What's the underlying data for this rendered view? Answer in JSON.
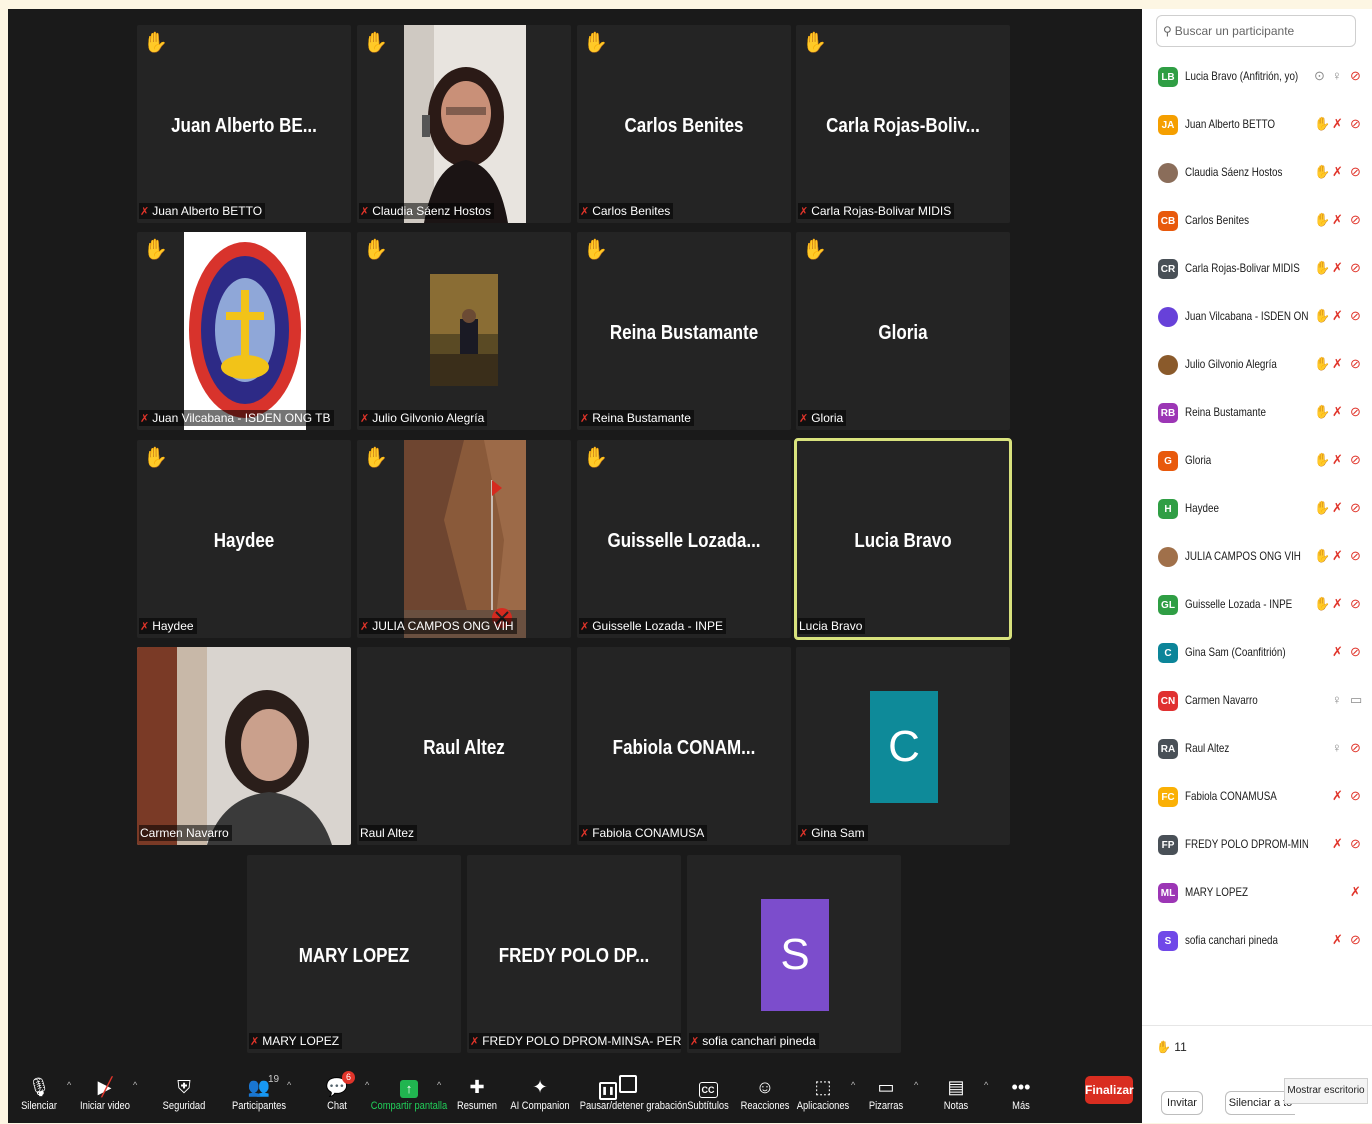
{
  "tiles": [
    {
      "center": "Juan Alberto BE...",
      "label": "Juan Alberto BETTO",
      "muted": true,
      "hand": true
    },
    {
      "center": "",
      "label": "Claudia Sáenz Hostos",
      "muted": true,
      "hand": true,
      "photo": "woman-smiling"
    },
    {
      "center": "Carlos Benites",
      "label": "Carlos Benites",
      "muted": true,
      "hand": true
    },
    {
      "center": "Carla Rojas-Boliv...",
      "label": "Carla Rojas-Bolivar MIDIS",
      "muted": true,
      "hand": true
    },
    {
      "center": "",
      "label": "Juan Vilcabana - ISDEN ONG TB",
      "muted": true,
      "hand": true,
      "photo": "instituto-logo",
      "logo_text": "INSTITUTO DE SALUD-MSC",
      "logo_sub": "CRISTOBAL BENEKE",
      "logo_motto": "Servir a la Vida"
    },
    {
      "center": "",
      "label": "Julio Gilvonio Alegría",
      "muted": true,
      "hand": true,
      "photo": "assembly-hall"
    },
    {
      "center": "Reina Bustamante",
      "label": "Reina Bustamante",
      "muted": true,
      "hand": true
    },
    {
      "center": "Gloria",
      "label": "Gloria",
      "muted": true,
      "hand": true
    },
    {
      "center": "Haydee",
      "label": "Haydee",
      "muted": true,
      "hand": true
    },
    {
      "center": "",
      "label": "JULIA CAMPOS  ONG VIH",
      "muted": true,
      "hand": true,
      "photo": "rock-cliff"
    },
    {
      "center": "Guisselle  Lozada...",
      "label": "Guisselle Lozada - INPE",
      "muted": true,
      "hand": true
    },
    {
      "center": "Lucia Bravo",
      "label": "Lucia Bravo",
      "muted": false,
      "hand": false,
      "active": true
    },
    {
      "center": "",
      "label": "Carmen Navarro",
      "muted": false,
      "hand": false,
      "photo": "live-video"
    },
    {
      "center": "Raul Altez",
      "label": "Raul Altez",
      "muted": false,
      "hand": false
    },
    {
      "center": "Fabiola  CONAM...",
      "label": "Fabiola CONAMUSA",
      "muted": true,
      "hand": false
    },
    {
      "center": "",
      "label": "Gina Sam",
      "muted": true,
      "hand": false,
      "avatar": "C",
      "avatar_color": "#0e8a99"
    },
    {
      "center": "MARY LOPEZ",
      "label": "MARY LOPEZ",
      "muted": true,
      "hand": false
    },
    {
      "center": "FREDY POLO DP...",
      "label": "FREDY POLO DPROM-MINSA- PERU",
      "muted": true,
      "hand": false
    },
    {
      "center": "",
      "label": "sofia canchari pineda",
      "muted": true,
      "hand": false,
      "avatar": "S",
      "avatar_color": "#7c4dcc"
    }
  ],
  "panel": {
    "search_placeholder": "Buscar un participante",
    "participants": [
      {
        "initials": "LB",
        "color": "#2f9e44",
        "name": "Lucia Bravo (Anfitrión, yo)",
        "icons": [
          "share",
          "mic",
          "vid-off"
        ]
      },
      {
        "initials": "JA",
        "color": "#f59f00",
        "name": "Juan Alberto BETTO",
        "icons": [
          "hand",
          "mic-off",
          "vid-off"
        ]
      },
      {
        "initials": "",
        "color": "#8a6d5a",
        "name": "Claudia Sáenz Hostos",
        "icons": [
          "hand-dim",
          "mic-off",
          "vid-off"
        ],
        "photo": true
      },
      {
        "initials": "CB",
        "color": "#e8590c",
        "name": "Carlos Benites",
        "icons": [
          "hand",
          "mic-off",
          "vid-off"
        ]
      },
      {
        "initials": "CR",
        "color": "#495057",
        "name": "Carla Rojas-Bolivar MIDIS",
        "icons": [
          "hand",
          "mic-off",
          "vid-off"
        ]
      },
      {
        "initials": "",
        "color": "#6741d9",
        "name": "Juan Vilcabana - ISDEN ON...",
        "icons": [
          "hand",
          "mic-off",
          "vid-off"
        ],
        "photo": true
      },
      {
        "initials": "",
        "color": "#8a5a2b",
        "name": "Julio Gilvonio Alegría",
        "icons": [
          "hand",
          "mic-off",
          "vid-off"
        ],
        "photo": true
      },
      {
        "initials": "RB",
        "color": "#9c36b5",
        "name": "Reina Bustamante",
        "icons": [
          "hand",
          "mic-off",
          "vid-off"
        ]
      },
      {
        "initials": "G",
        "color": "#e8590c",
        "name": "Gloria",
        "icons": [
          "hand",
          "mic-off",
          "vid-off"
        ]
      },
      {
        "initials": "H",
        "color": "#2f9e44",
        "name": "Haydee",
        "icons": [
          "hand",
          "mic-off",
          "vid-off"
        ]
      },
      {
        "initials": "",
        "color": "#a0704a",
        "name": "JULIA CAMPOS  ONG VIH",
        "icons": [
          "hand",
          "mic-off",
          "vid-off"
        ],
        "photo": true
      },
      {
        "initials": "GL",
        "color": "#2f9e44",
        "name": "Guisselle Lozada - INPE",
        "icons": [
          "hand",
          "mic-off",
          "vid-off"
        ]
      },
      {
        "initials": "C",
        "color": "#0c8599",
        "name": "Gina Sam (Coanfitrión)",
        "icons": [
          "mic-off",
          "vid-off"
        ]
      },
      {
        "initials": "CN",
        "color": "#e03131",
        "name": "Carmen Navarro",
        "icons": [
          "mic",
          "vid"
        ]
      },
      {
        "initials": "RA",
        "color": "#495057",
        "name": "Raul Altez",
        "icons": [
          "mic",
          "vid-off"
        ]
      },
      {
        "initials": "FC",
        "color": "#fab005",
        "name": "Fabiola CONAMUSA",
        "icons": [
          "mic-off",
          "vid-off"
        ]
      },
      {
        "initials": "FP",
        "color": "#495057",
        "name": "FREDY POLO DPROM-MINSA- P...",
        "icons": [
          "mic-off",
          "vid-off"
        ]
      },
      {
        "initials": "ML",
        "color": "#9c36b5",
        "name": "MARY LOPEZ",
        "icons": [
          "mic-off"
        ]
      },
      {
        "initials": "S",
        "color": "#7048e8",
        "name": "sofia canchari pineda",
        "icons": [
          "mic-off",
          "vid-off"
        ]
      }
    ],
    "hand_count": "11",
    "invite_label": "Invitar",
    "mute_all_label": "Silenciar a to",
    "tooltip": "Mostrar escritorio"
  },
  "toolbar": [
    {
      "id": "mute",
      "label": "Silenciar",
      "icon": "🎙",
      "caret": true
    },
    {
      "id": "video",
      "label": "Iniciar video",
      "icon": "✕",
      "caret": true
    },
    {
      "id": "security",
      "label": "Seguridad",
      "icon": "⛨"
    },
    {
      "id": "participants",
      "label": "Participantes",
      "icon": "👥",
      "badge": "19",
      "caret": true
    },
    {
      "id": "chat",
      "label": "Chat",
      "icon": "💬",
      "badge": "6",
      "caret": true
    },
    {
      "id": "share",
      "label": "Compartir pantalla",
      "icon": "↑",
      "caret": true
    },
    {
      "id": "summary",
      "label": "Resumen",
      "icon": "✚"
    },
    {
      "id": "companion",
      "label": "AI Companion",
      "icon": "✦"
    },
    {
      "id": "record",
      "label": "Pausar/detener grabación",
      "icon": "⏸"
    },
    {
      "id": "subtitles",
      "label": "Subtítulos",
      "icon": "CC"
    },
    {
      "id": "reactions",
      "label": "Reacciones",
      "icon": "☺"
    },
    {
      "id": "apps",
      "label": "Aplicaciones",
      "icon": "⬚",
      "caret": true
    },
    {
      "id": "whiteboards",
      "label": "Pizarras",
      "icon": "▭",
      "caret": true
    },
    {
      "id": "notes",
      "label": "Notas",
      "icon": "▤",
      "caret": true
    },
    {
      "id": "more",
      "label": "Más",
      "icon": "•••"
    }
  ],
  "end_label": "Finalizar"
}
